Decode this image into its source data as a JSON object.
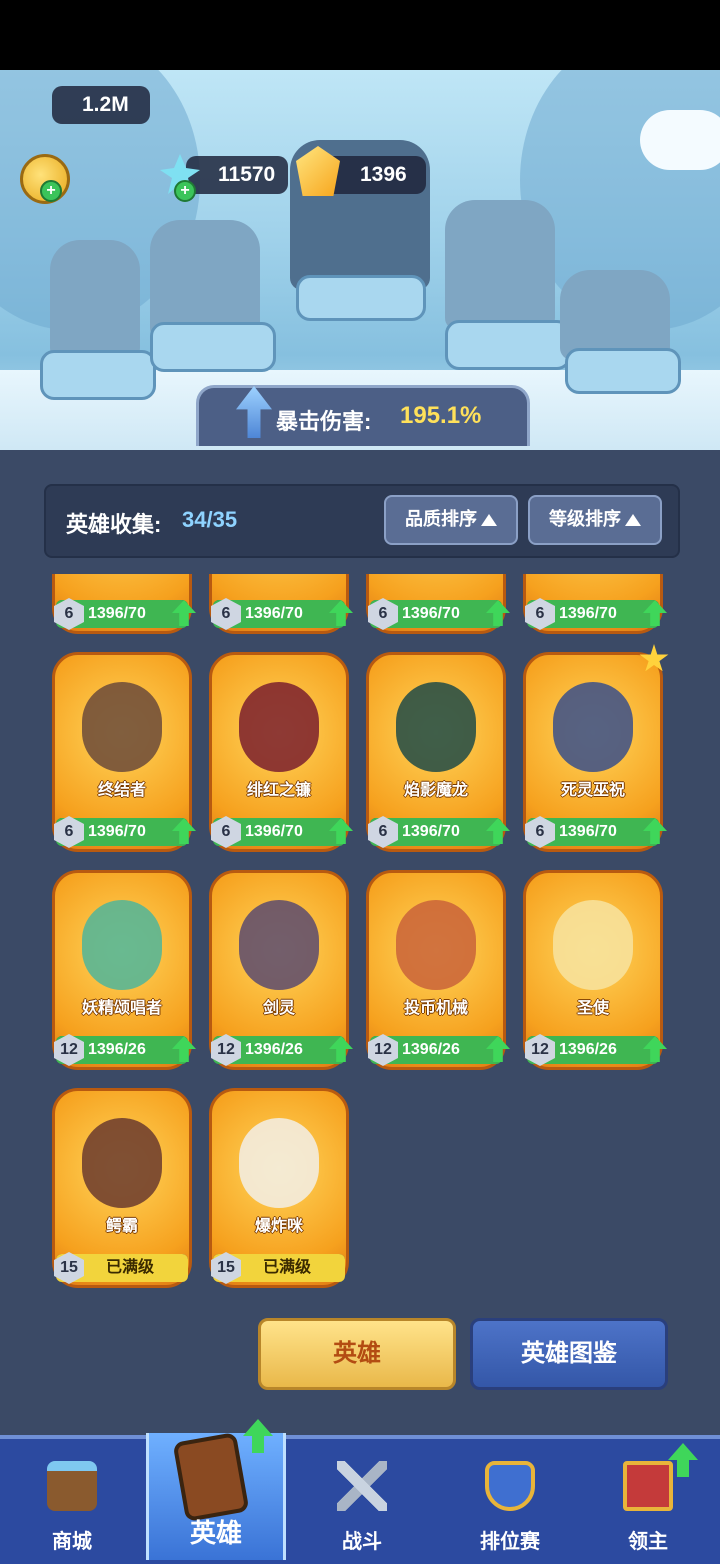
{
  "resources": {
    "gold": "1.2M",
    "crystals": "11570",
    "gems": "1396"
  },
  "banner": {
    "label": "暴击伤害:",
    "value": "195.1%"
  },
  "collection": {
    "label": "英雄收集:",
    "value": "34/35"
  },
  "sort": {
    "quality": "品质排序",
    "level": "等级排序"
  },
  "row0": [
    {
      "level": "6",
      "progress": "1396/70",
      "fill": 1.0
    },
    {
      "level": "6",
      "progress": "1396/70",
      "fill": 1.0
    },
    {
      "level": "6",
      "progress": "1396/70",
      "fill": 1.0
    },
    {
      "level": "6",
      "progress": "1396/70",
      "fill": 1.0
    }
  ],
  "row1": [
    {
      "name": "终结者",
      "level": "6",
      "progress": "1396/70",
      "fill": 1.0
    },
    {
      "name": "绯红之镰",
      "level": "6",
      "progress": "1396/70",
      "fill": 1.0
    },
    {
      "name": "焰影魔龙",
      "level": "6",
      "progress": "1396/70",
      "fill": 1.0
    },
    {
      "name": "死灵巫祝",
      "level": "6",
      "progress": "1396/70",
      "fill": 1.0
    }
  ],
  "row2": [
    {
      "name": "妖精颂唱者",
      "level": "12",
      "progress": "1396/26",
      "fill": 1.0
    },
    {
      "name": "剑灵",
      "level": "12",
      "progress": "1396/26",
      "fill": 1.0
    },
    {
      "name": "投币机械",
      "level": "12",
      "progress": "1396/26",
      "fill": 1.0
    },
    {
      "name": "圣使",
      "level": "12",
      "progress": "1396/26",
      "fill": 1.0
    }
  ],
  "row3": [
    {
      "name": "鳄霸",
      "level": "15",
      "progress": "已满级",
      "fill": 1.0
    },
    {
      "name": "爆炸咪",
      "level": "15",
      "progress": "已满级",
      "fill": 1.0
    }
  ],
  "buttons": {
    "hero": "英雄",
    "codex": "英雄图鉴"
  },
  "nav": [
    {
      "label": "商城",
      "icon": "chest-icon"
    },
    {
      "label": "英雄",
      "icon": "hero-card-icon"
    },
    {
      "label": "战斗",
      "icon": "crossed-swords-icon"
    },
    {
      "label": "排位赛",
      "icon": "rank-shield-icon"
    },
    {
      "label": "领主",
      "icon": "castle-banner-icon"
    }
  ],
  "colors": {
    "panel": "#3b4a66",
    "card_orange": "#f6a11e",
    "progress_green": "#3fb652",
    "max_yellow": "#f2d43c",
    "nav_blue": "#2c4aa0"
  }
}
